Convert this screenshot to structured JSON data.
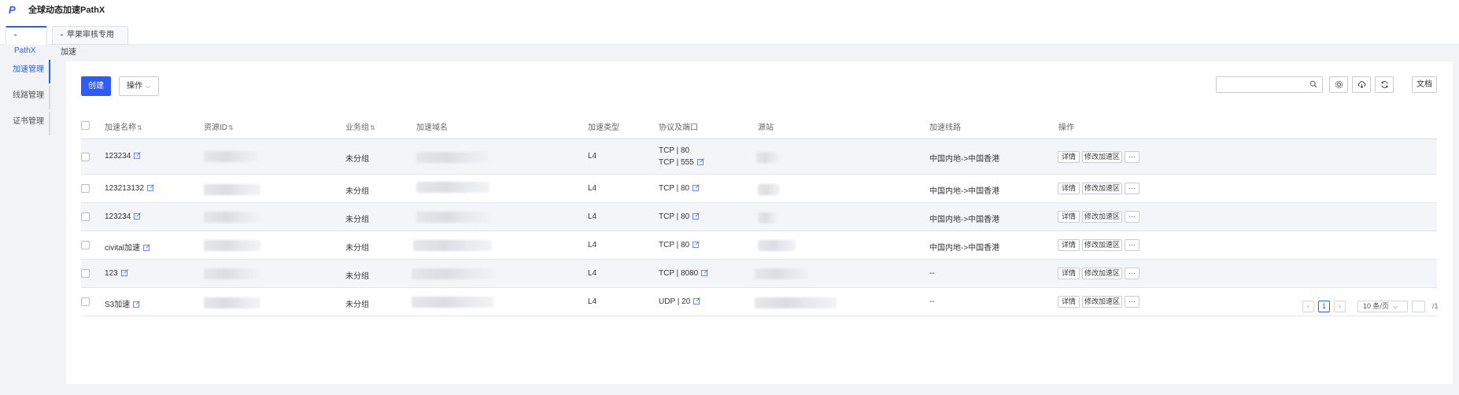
{
  "app": {
    "logo": "P",
    "title": "全球动态加速PathX"
  },
  "tabs": [
    {
      "label": "PathX"
    },
    {
      "label": "苹果审核专用加速"
    }
  ],
  "sidenav": [
    {
      "label": "加速管理"
    },
    {
      "label": "线路管理"
    },
    {
      "label": "证书管理"
    }
  ],
  "toolbar": {
    "create_label": "创建",
    "ops_label": "操作",
    "search_placeholder": "",
    "doc_label": "文档"
  },
  "table": {
    "headers": {
      "name": "加速名称",
      "resource_id": "资源ID",
      "group": "业务组",
      "domain": "加速域名",
      "type": "加速类型",
      "protocol": "协议及端口",
      "origin": "源站",
      "line": "加速线路",
      "ops": "操作"
    },
    "rows": [
      {
        "name": "123234",
        "group": "未分组",
        "type": "L4",
        "protocol_1": "TCP | 80",
        "protocol_2": "TCP | 555",
        "line": "中国内地->中国香港"
      },
      {
        "name": "123213132",
        "group": "未分组",
        "type": "L4",
        "protocol_1": "TCP | 80",
        "line": "中国内地->中国香港"
      },
      {
        "name": "123234",
        "group": "未分组",
        "type": "L4",
        "protocol_1": "TCP | 80",
        "line": "中国内地->中国香港"
      },
      {
        "name": "civital加速",
        "group": "未分组",
        "type": "L4",
        "protocol_1": "TCP | 80",
        "line": "中国内地->中国香港"
      },
      {
        "name": "123",
        "group": "未分组",
        "type": "L4",
        "protocol_1": "TCP | 8080",
        "line": "--"
      },
      {
        "name": "S3加速",
        "group": "未分组",
        "type": "L4",
        "protocol_1": "UDP | 20",
        "line": "--"
      }
    ],
    "actions": {
      "detail": "详情",
      "modify_region": "修改加速区",
      "more": "···"
    }
  },
  "pagination": {
    "prev": "‹",
    "next": "›",
    "current_page": "1",
    "page_size": "10 条/页",
    "jump_value": "",
    "total": "/1"
  },
  "colors": {
    "accent": "#2f5cf5",
    "background": "#f2f3f7",
    "row_shade": "#f4f5f9"
  }
}
